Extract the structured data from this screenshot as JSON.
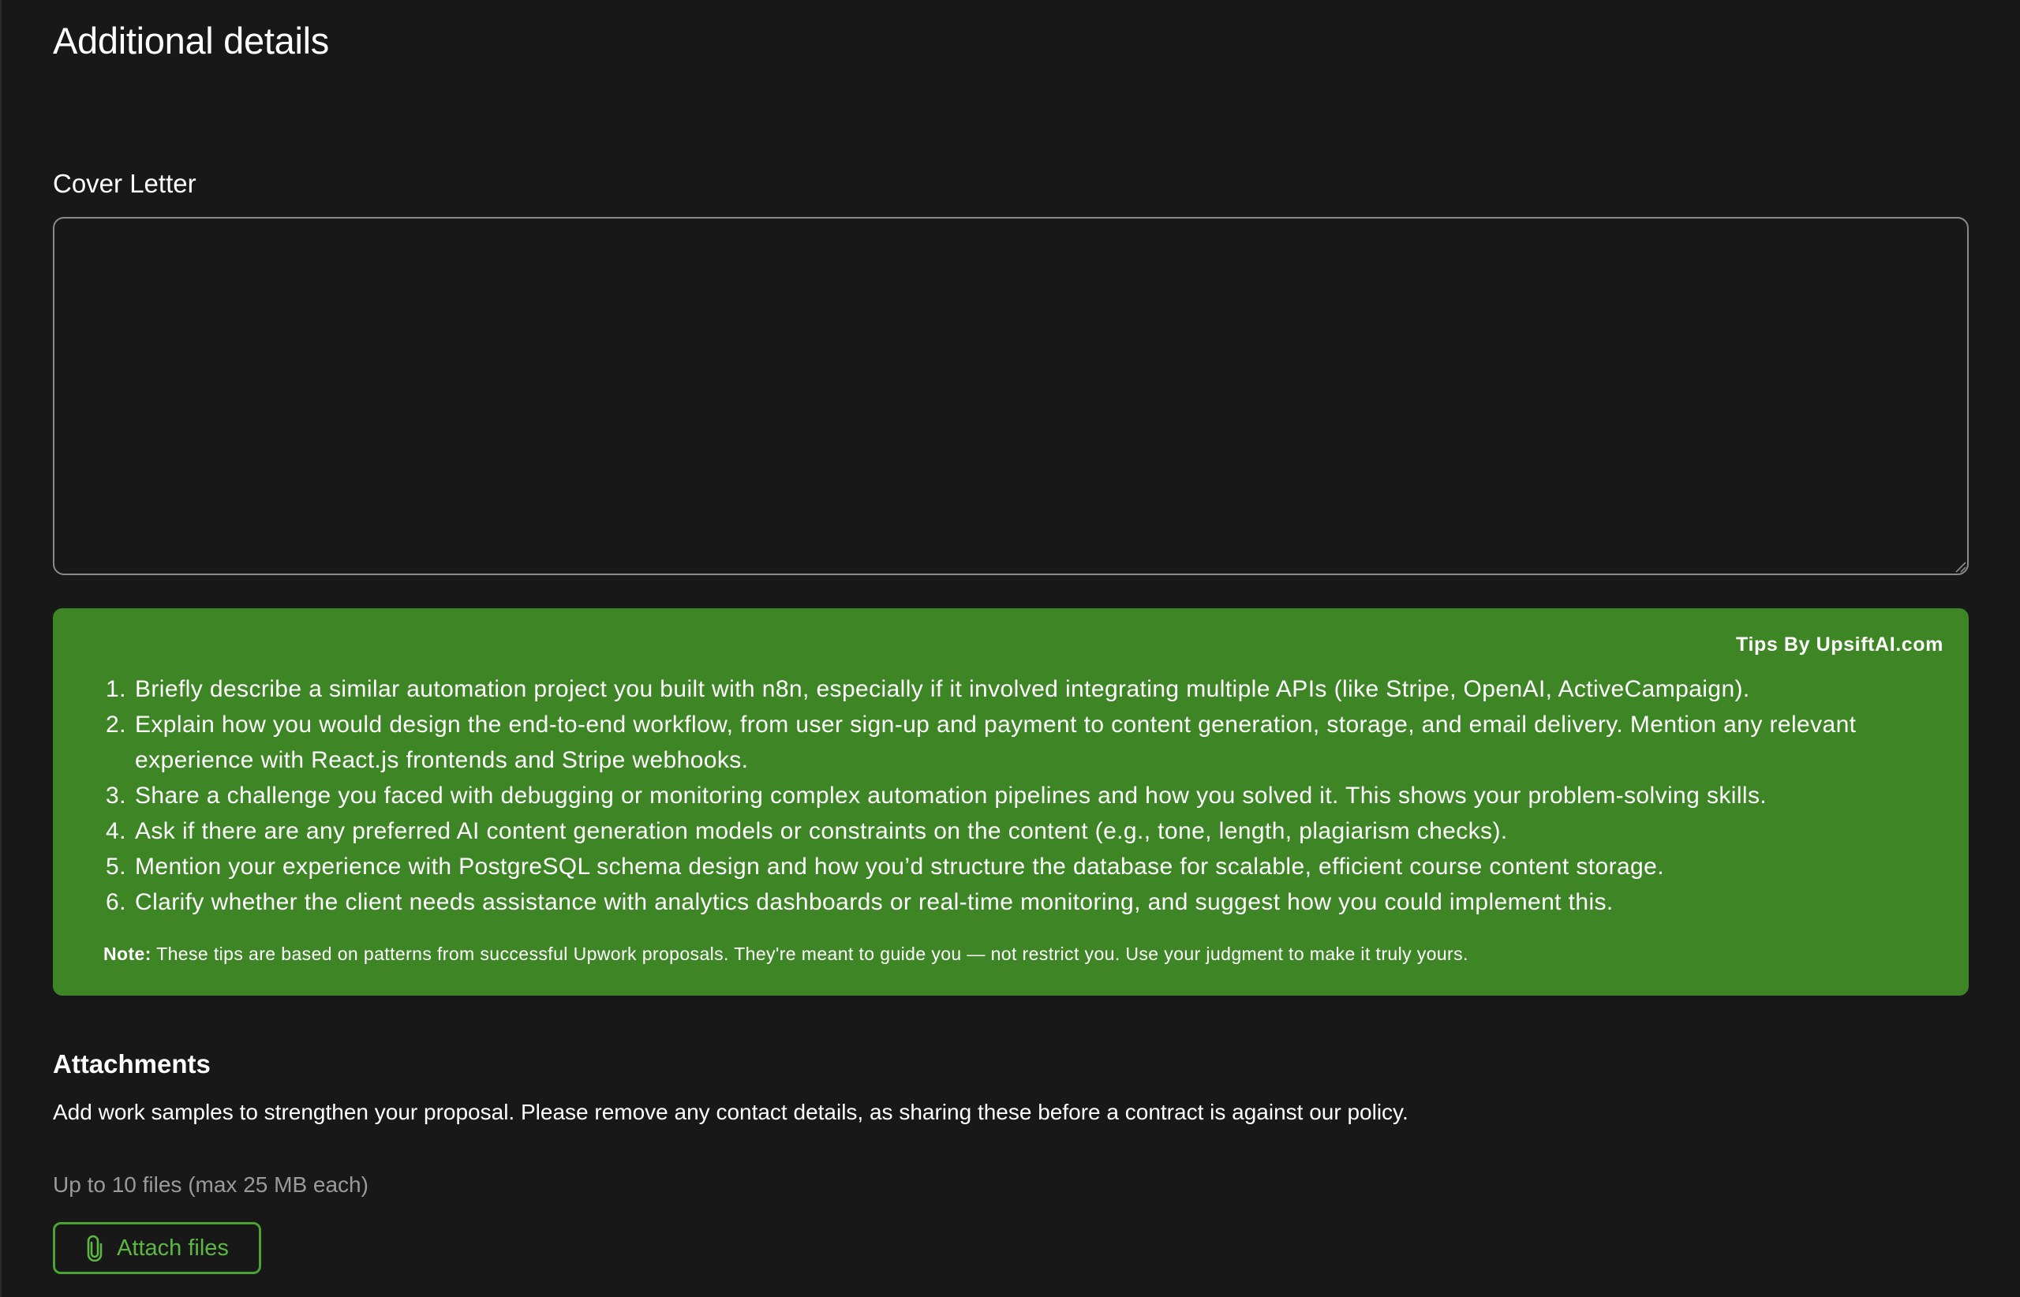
{
  "section": {
    "title": "Additional details"
  },
  "cover_letter": {
    "label": "Cover Letter",
    "value": ""
  },
  "tips": {
    "brand": "Tips By UpsiftAI.com",
    "items": [
      {
        "num": "1.",
        "text": "Briefly describe a similar automation project you built with n8n, especially if it involved integrating multiple APIs (like Stripe, OpenAI, ActiveCampaign)."
      },
      {
        "num": "2.",
        "text": "Explain how you would design the end-to-end workflow, from user sign-up and payment to content generation, storage, and email delivery. Mention any relevant experience with React.js frontends and Stripe webhooks."
      },
      {
        "num": "3.",
        "text": "Share a challenge you faced with debugging or monitoring complex automation pipelines and how you solved it. This shows your problem-solving skills."
      },
      {
        "num": "4.",
        "text": "Ask if there are any preferred AI content generation models or constraints on the content (e.g., tone, length, plagiarism checks)."
      },
      {
        "num": "5.",
        "text": "Mention your experience with PostgreSQL schema design and how you’d structure the database for scalable, efficient course content storage."
      },
      {
        "num": "6.",
        "text": "Clarify whether the client needs assistance with analytics dashboards or real-time monitoring, and suggest how you could implement this."
      }
    ],
    "note_label": "Note:",
    "note_text": " These tips are based on patterns from successful Upwork proposals. They're meant to guide you — not restrict you. Use your judgment to make it truly yours."
  },
  "attachments": {
    "title": "Attachments",
    "description": "Add work samples to strengthen your proposal. Please remove any contact details, as sharing these before a contract is against our policy.",
    "limit": "Up to 10 files (max 25 MB each)",
    "button_label": "Attach files",
    "button_icon": "paperclip-icon"
  },
  "colors": {
    "background": "#181818",
    "tips_background": "#3e8526",
    "accent": "#4aa332"
  }
}
